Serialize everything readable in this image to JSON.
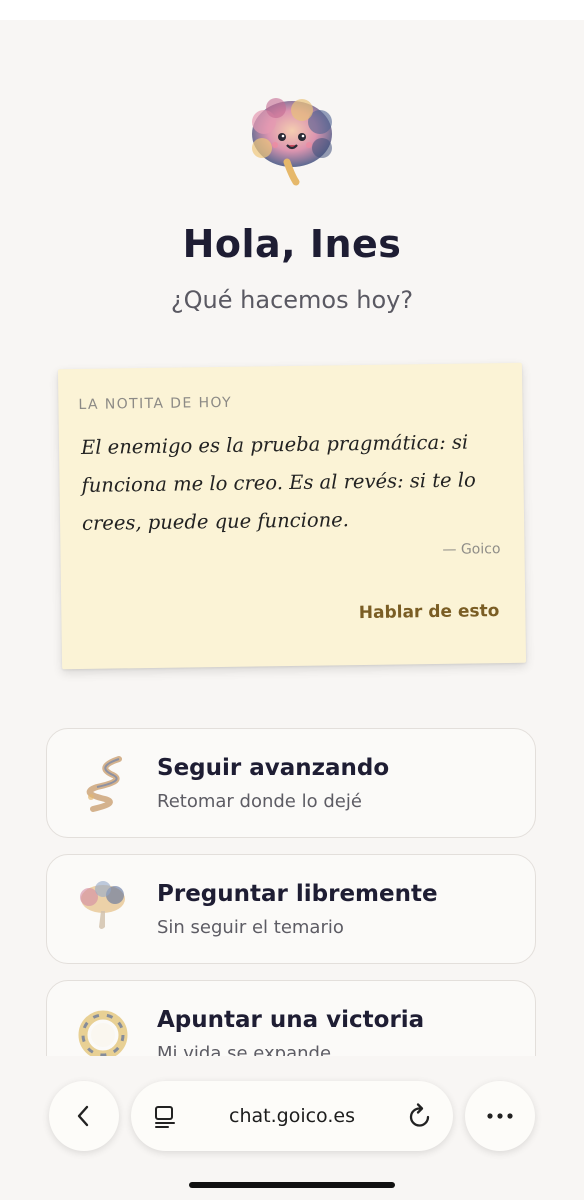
{
  "header": {
    "greeting": "Hola, Ines",
    "subtitle": "¿Qué hacemos hoy?"
  },
  "note": {
    "label": "LA NOTITA DE HOY",
    "quote": "El enemigo es la prueba pragmática: si funciona me lo creo. Es al revés: si te lo crees, puede que funcione.",
    "author": "— Goico",
    "action": "Hablar de esto"
  },
  "cards": [
    {
      "title": "Seguir avanzando",
      "subtitle": "Retomar donde lo dejé",
      "icon": "path-icon"
    },
    {
      "title": "Preguntar libremente",
      "subtitle": "Sin seguir el temario",
      "icon": "cloud-icon"
    },
    {
      "title": "Apuntar una victoria",
      "subtitle": "Mi vida se expande",
      "icon": "wreath-icon"
    }
  ],
  "browser": {
    "url": "chat.goico.es"
  },
  "colors": {
    "background": "#f8f6f4",
    "note_bg": "#fbf3d6",
    "action": "#7a5d24"
  }
}
